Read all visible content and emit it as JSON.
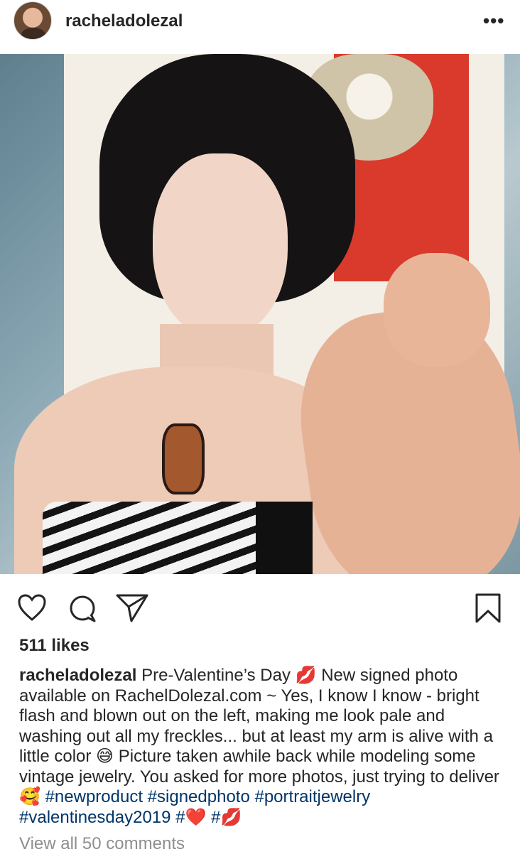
{
  "post": {
    "username": "racheladolezal",
    "more_label": "•••",
    "likes": "511 likes",
    "caption": {
      "username": "racheladolezal",
      "text": "Pre-Valentine’s Day 💋 New signed photo available on RachelDolezal.com ~ Yes, I know I know - bright flash and blown out on the left, making me look pale and washing out all my freckles... but at least my arm is alive with a little color 😅 Picture taken awhile back while modeling some vintage jewelry. You asked for more photos, just trying to deliver 🥰",
      "hashtags": [
        "#newproduct",
        "#signedphoto",
        "#portraitjewelry",
        "#valentinesday2019",
        "#❤️",
        "#💋"
      ]
    },
    "view_comments": "View all 50 comments"
  },
  "icons": {
    "like": "heart-icon",
    "comment": "comment-bubble-icon",
    "share": "paper-plane-icon",
    "save": "bookmark-icon",
    "more": "more-dots-icon"
  },
  "colors": {
    "text": "#262626",
    "hashtag": "#003569",
    "muted": "#8e8e8e"
  }
}
